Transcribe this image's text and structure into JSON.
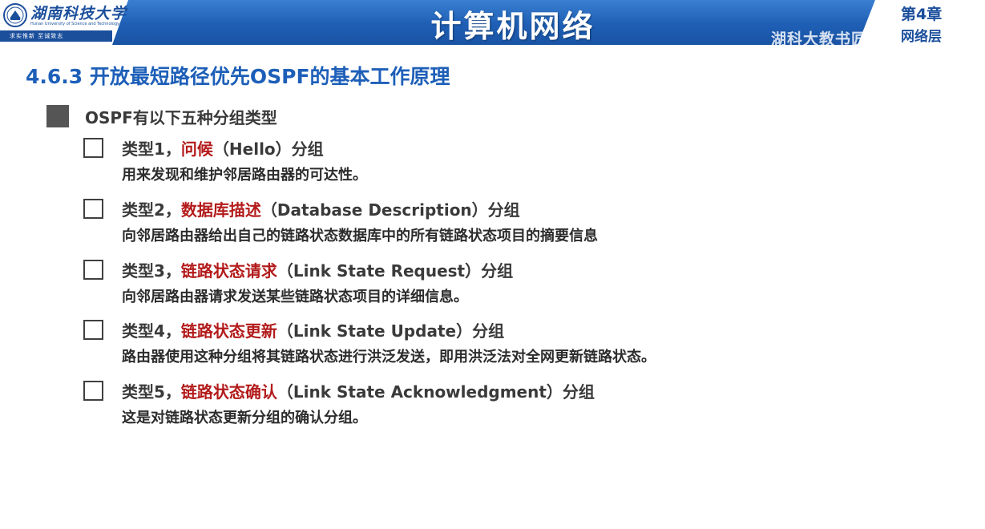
{
  "header": {
    "university_name": "湖南科技大学",
    "university_en": "Hunan University of Science and Technology",
    "motto": "求实惟新  至诚致志",
    "course_title": "计算机网络",
    "chapter_number": "第4章",
    "chapter_name": "网络层",
    "watermark": "湖科大教书匠",
    "colors": {
      "header_blue": "#1e5fb5",
      "logo_blue": "#1b4f9c"
    }
  },
  "slide": {
    "section_title": "4.6.3 开放最短路径优先OSPF的基本工作原理",
    "intro": "OSPF有以下五种分组类型",
    "highlight_color": "#b31b1b",
    "items": [
      {
        "prefix": "类型1，",
        "name": "问候",
        "suffix": "（Hello）分组",
        "description": "用来发现和维护邻居路由器的可达性。"
      },
      {
        "prefix": "类型2，",
        "name": "数据库描述",
        "suffix": "（Database Description）分组",
        "description": "向邻居路由器给出自己的链路状态数据库中的所有链路状态项目的摘要信息"
      },
      {
        "prefix": "类型3，",
        "name": "链路状态请求",
        "suffix": "（Link State Request）分组",
        "description": "向邻居路由器请求发送某些链路状态项目的详细信息。"
      },
      {
        "prefix": "类型4，",
        "name": "链路状态更新",
        "suffix": "（Link State Update）分组",
        "description": "路由器使用这种分组将其链路状态进行洪泛发送，即用洪泛法对全网更新链路状态。"
      },
      {
        "prefix": "类型5，",
        "name": "链路状态确认",
        "suffix": "（Link State Acknowledgment）分组",
        "description": "这是对链路状态更新分组的确认分组。"
      }
    ]
  }
}
